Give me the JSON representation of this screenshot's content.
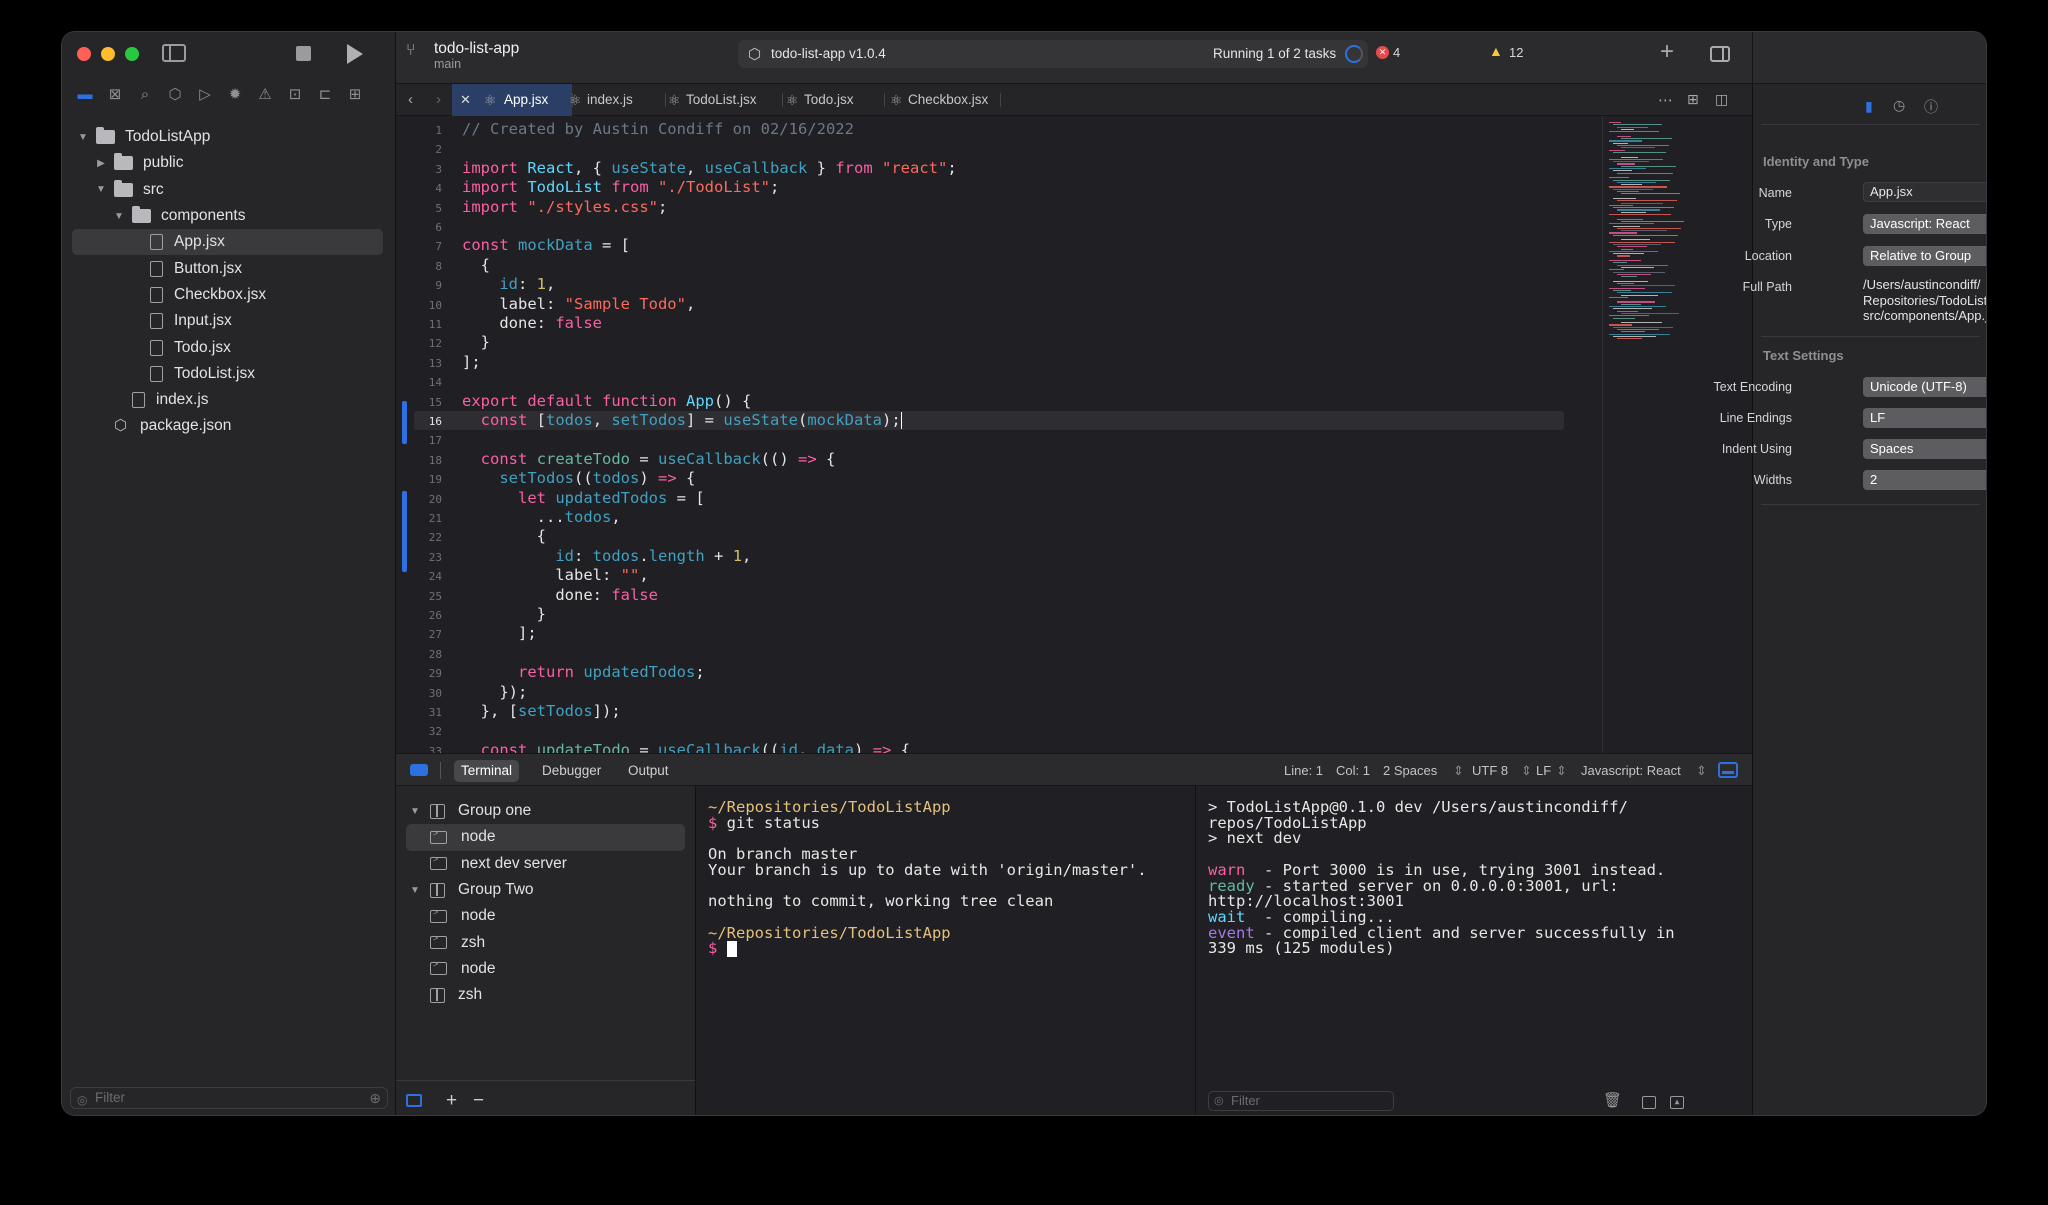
{
  "project": {
    "name": "todo-list-app",
    "branch": "main"
  },
  "activity": {
    "scheme": "todo-list-app v1.0.4",
    "status": "Running 1 of 2 tasks",
    "errors": "4",
    "warnings": "12"
  },
  "navigator": {
    "tree": [
      {
        "label": "TodoListApp",
        "kind": "folder",
        "depth": 0,
        "open": true
      },
      {
        "label": "public",
        "kind": "folder",
        "depth": 1,
        "open": false
      },
      {
        "label": "src",
        "kind": "folder",
        "depth": 1,
        "open": true
      },
      {
        "label": "components",
        "kind": "folder",
        "depth": 2,
        "open": true
      },
      {
        "label": "App.jsx",
        "kind": "file",
        "depth": 3,
        "selected": true
      },
      {
        "label": "Button.jsx",
        "kind": "file",
        "depth": 3
      },
      {
        "label": "Checkbox.jsx",
        "kind": "file",
        "depth": 3
      },
      {
        "label": "Input.jsx",
        "kind": "file",
        "depth": 3
      },
      {
        "label": "Todo.jsx",
        "kind": "file",
        "depth": 3
      },
      {
        "label": "TodoList.jsx",
        "kind": "file",
        "depth": 3
      },
      {
        "label": "index.js",
        "kind": "file",
        "depth": 2
      },
      {
        "label": "package.json",
        "kind": "package",
        "depth": 1
      }
    ],
    "filter_placeholder": "Filter"
  },
  "tabs": [
    {
      "label": "App.jsx",
      "active": true
    },
    {
      "label": "index.js"
    },
    {
      "label": "TodoList.jsx"
    },
    {
      "label": "Todo.jsx"
    },
    {
      "label": "Checkbox.jsx"
    }
  ],
  "editor": {
    "current_line": 16,
    "lines": [
      "// Created by Austin Condiff on 02/16/2022",
      "",
      "import React, { useState, useCallback } from \"react\";",
      "import TodoList from \"./TodoList\";",
      "import \"./styles.css\";",
      "",
      "const mockData = [",
      "  {",
      "    id: 1,",
      "    label: \"Sample Todo\",",
      "    done: false",
      "  }",
      "];",
      "",
      "export default function App() {",
      "  const [todos, setTodos] = useState(mockData);",
      "",
      "  const createTodo = useCallback(() => {",
      "    setTodos((todos) => {",
      "      let updatedTodos = [",
      "        ...todos,",
      "        {",
      "          id: todos.length + 1,",
      "          label: \"\",",
      "          done: false",
      "        }",
      "      ];",
      "",
      "      return updatedTodos;",
      "    });",
      "  }, [setTodos]);",
      "",
      "  const updateTodo = useCallback((id, data) => {"
    ]
  },
  "debug": {
    "tabs": [
      "Terminal",
      "Debugger",
      "Output"
    ],
    "line": "Line: 1",
    "col": "Col: 1",
    "indent": "2 Spaces",
    "encoding": "UTF 8",
    "endings": "LF",
    "language": "Javascript: React"
  },
  "terminal_tree": [
    {
      "label": "Group one",
      "kind": "group",
      "depth": 0
    },
    {
      "label": "node",
      "kind": "term",
      "depth": 1,
      "selected": true
    },
    {
      "label": "next dev server",
      "kind": "term",
      "depth": 1
    },
    {
      "label": "Group Two",
      "kind": "group",
      "depth": 0
    },
    {
      "label": "node",
      "kind": "term",
      "depth": 1
    },
    {
      "label": "zsh",
      "kind": "term",
      "depth": 1
    },
    {
      "label": "node",
      "kind": "term",
      "depth": 1
    },
    {
      "label": "zsh",
      "kind": "single",
      "depth": 0
    }
  ],
  "terminal1": [
    {
      "t": "~/Repositories/TodoListApp",
      "c": "tpath"
    },
    {
      "t": "$ git status",
      "c": ""
    },
    {
      "t": "",
      "c": ""
    },
    {
      "t": "On branch master",
      "c": ""
    },
    {
      "t": "Your branch is up to date with 'origin/master'.",
      "c": ""
    },
    {
      "t": "",
      "c": ""
    },
    {
      "t": "nothing to commit, working tree clean",
      "c": ""
    },
    {
      "t": "",
      "c": ""
    },
    {
      "t": "~/Repositories/TodoListApp",
      "c": "tpath"
    },
    {
      "t": "$ ",
      "c": ""
    }
  ],
  "terminal2": [
    {
      "k": "",
      "t": "> TodoListApp@0.1.0 dev /Users/austincondiff/"
    },
    {
      "k": "",
      "t": "repos/TodoListApp"
    },
    {
      "k": "",
      "t": "> next dev"
    },
    {
      "k": "",
      "t": ""
    },
    {
      "k": "warn",
      "t": "  - Port 3000 is in use, trying 3001 instead."
    },
    {
      "k": "ready",
      "t": " - started server on 0.0.0.0:3001, url:"
    },
    {
      "k": "",
      "t": "http://localhost:3001"
    },
    {
      "k": "wait",
      "t": "  - compiling..."
    },
    {
      "k": "event",
      "t": " - compiled client and server successfully in"
    },
    {
      "k": "",
      "t": "339 ms (125 modules)"
    }
  ],
  "terminal_filter_placeholder": "Filter",
  "inspector": {
    "identity_header": "Identity and Type",
    "name_label": "Name",
    "name_value": "App.jsx",
    "type_label": "Type",
    "type_value": "Javascript: React",
    "location_label": "Location",
    "location_value": "Relative to Group",
    "fullpath_label": "Full Path",
    "fullpath_lines": [
      "/Users/austincondiff/",
      "Repositories/TodoListApp/",
      "src/components/App.jsx"
    ],
    "text_header": "Text Settings",
    "encoding_label": "Text Encoding",
    "encoding_value": "Unicode (UTF-8)",
    "endings_label": "Line Endings",
    "endings_value": "LF",
    "indent_label": "Indent Using",
    "indent_value": "Spaces",
    "widths_label": "Widths",
    "widths_value": "2"
  },
  "colors": {
    "accent": "#2f70e0",
    "window": "#1f1f24",
    "sidebar": "#262628",
    "close": "#ff5f57",
    "minimize": "#febc2e",
    "zoom": "#28c840"
  }
}
